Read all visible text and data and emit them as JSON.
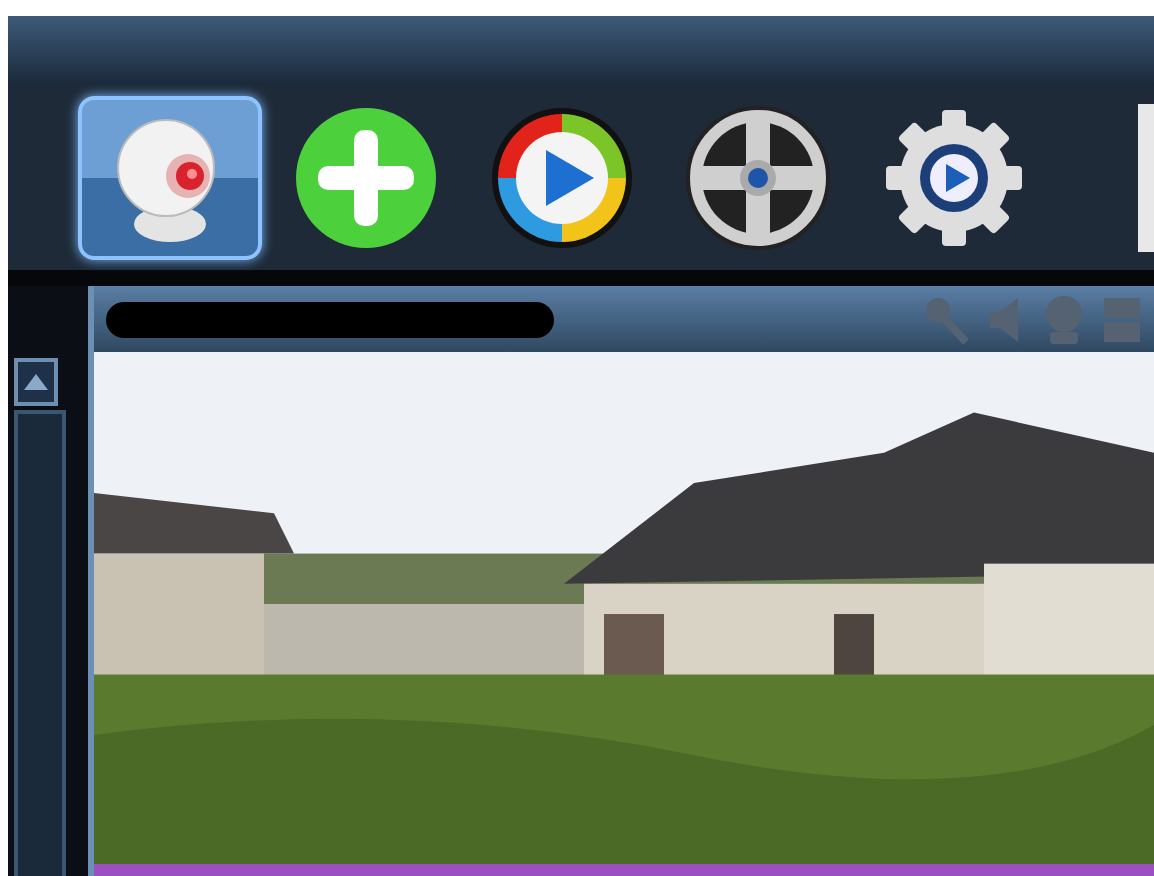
{
  "toolbar": [
    {
      "kind": "camera",
      "selected": true
    },
    {
      "kind": "add",
      "selected": false
    },
    {
      "kind": "play",
      "selected": false
    },
    {
      "kind": "reel",
      "selected": false
    },
    {
      "kind": "settings",
      "selected": false
    }
  ],
  "viewer": {
    "controls": [
      {
        "kind": "microphone",
        "disabled": true
      },
      {
        "kind": "speaker",
        "disabled": true
      },
      {
        "kind": "camera",
        "disabled": true
      },
      {
        "kind": "layout",
        "disabled": true
      }
    ],
    "selected": true
  }
}
